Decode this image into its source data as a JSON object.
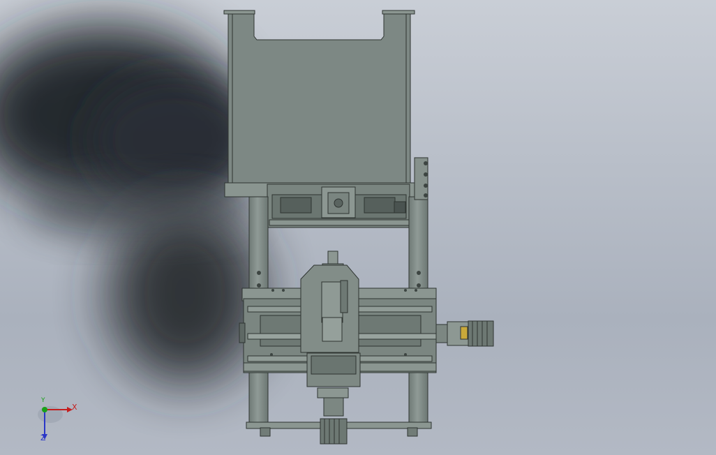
{
  "viewport": {
    "background_top": "#c9ced6",
    "background_bottom": "#aab1bd",
    "model_color": "#7f8a85"
  },
  "triad": {
    "x_label": "X",
    "y_label": "Y",
    "z_label": "Z",
    "x_color": "#c41f1f",
    "y_color": "#19a019",
    "z_color": "#2a36c8"
  }
}
